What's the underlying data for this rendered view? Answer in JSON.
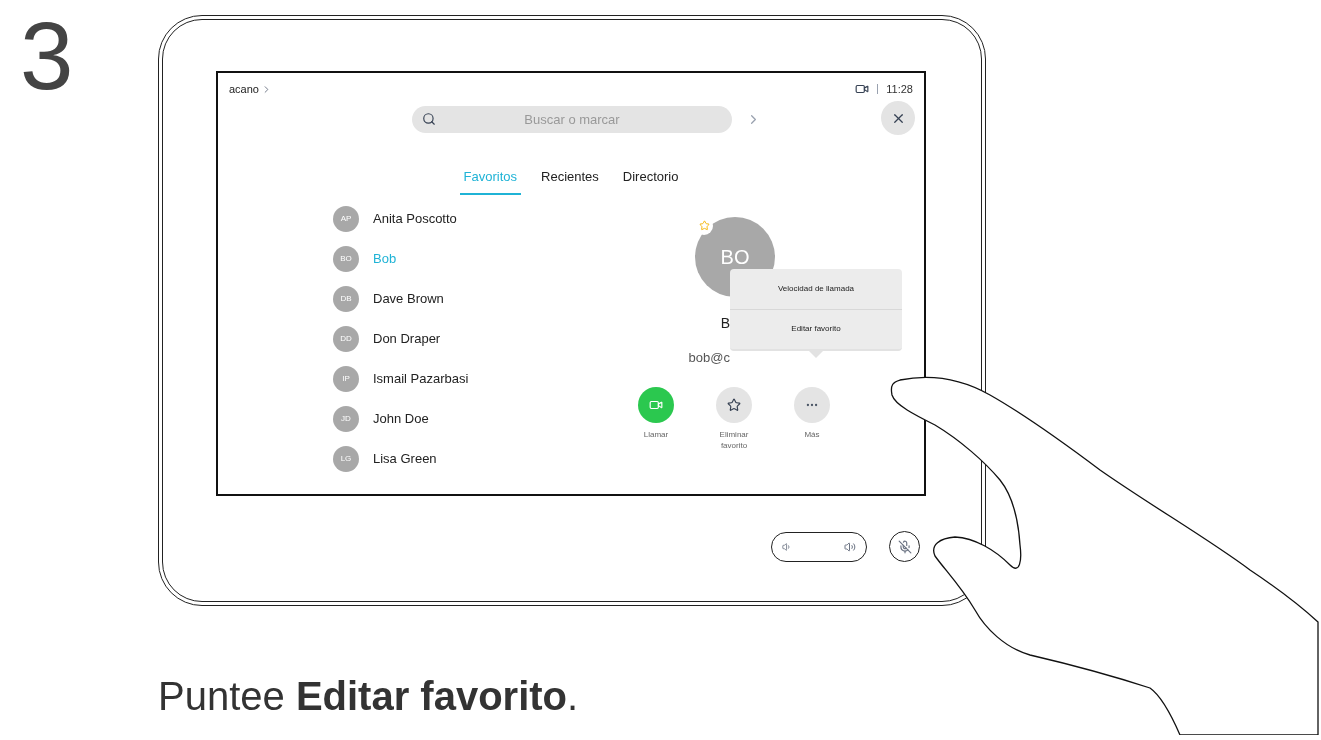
{
  "step": "3",
  "header": {
    "breadcrumb": "acano",
    "time": "11:28"
  },
  "search": {
    "placeholder": "Buscar o marcar"
  },
  "tabs": [
    {
      "label": "Favoritos",
      "selected": true
    },
    {
      "label": "Recientes",
      "selected": false
    },
    {
      "label": "Directorio",
      "selected": false
    }
  ],
  "contacts": [
    {
      "initials": "AP",
      "name": "Anita Poscotto",
      "selected": false
    },
    {
      "initials": "BO",
      "name": "Bob",
      "selected": true
    },
    {
      "initials": "DB",
      "name": "Dave Brown",
      "selected": false
    },
    {
      "initials": "DD",
      "name": "Don Draper",
      "selected": false
    },
    {
      "initials": "IP",
      "name": "Ismail Pazarbasi",
      "selected": false
    },
    {
      "initials": "JD",
      "name": "John Doe",
      "selected": false
    },
    {
      "initials": "LG",
      "name": "Lisa Green",
      "selected": false
    }
  ],
  "detail": {
    "initials": "BO",
    "favorite": true,
    "name": "B",
    "email": "bob@c",
    "actions": [
      {
        "kind": "call",
        "label": "Llamar"
      },
      {
        "kind": "unfavorite",
        "label": "Eliminar favorito"
      },
      {
        "kind": "more",
        "label": "Más"
      }
    ]
  },
  "menu": [
    {
      "label": "Velocidad de llamada"
    },
    {
      "label": "Editar favorito"
    }
  ],
  "caption": "Puntee **Editar favorito**."
}
